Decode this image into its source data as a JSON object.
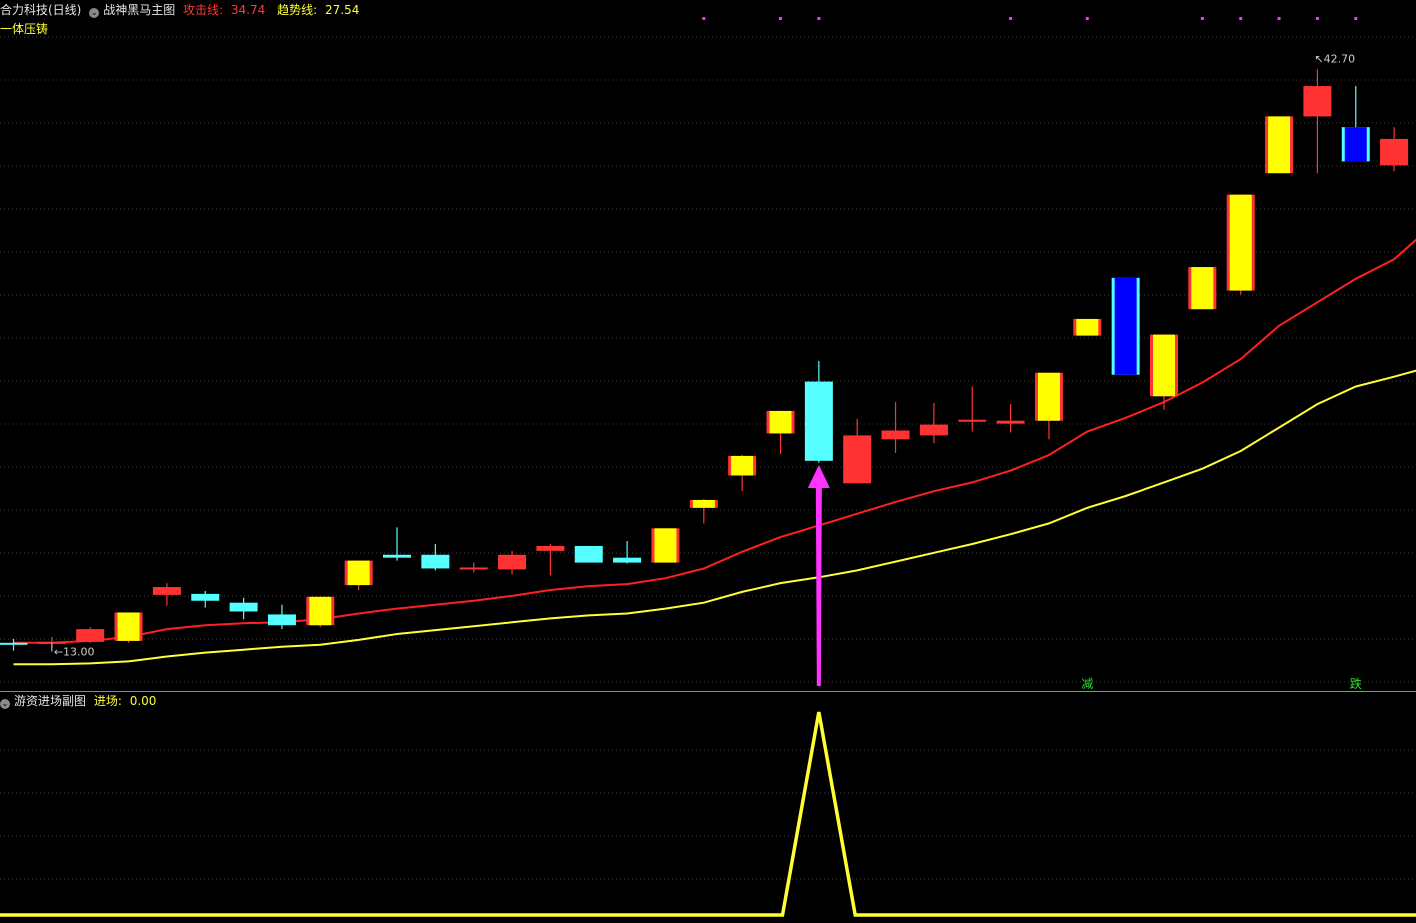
{
  "header": {
    "stock_name": "合力科技(日线)",
    "main_indicator": "战神黑马主图",
    "attack_label": "攻击线:",
    "attack_value": "34.74",
    "trend_label": "趋势线:",
    "trend_value": "27.54",
    "subtitle": "一体压铸"
  },
  "sub_header": {
    "indicator": "游资进场副图",
    "entry_label": "进场:",
    "entry_value": "0.00"
  },
  "colors": {
    "background": "#000000",
    "up_candle": "#ff3333",
    "down_candle": "#55ffff",
    "highlight_fill": "#ffff00",
    "attack_line": "#ff2020",
    "trend_line": "#ffff33",
    "signal_dot": "#ff33ff",
    "arrow": "#ff33ff",
    "marker_text": "#33dd33",
    "grid": "#3a3a3a"
  },
  "chart_data": [
    {
      "type": "candlestick",
      "title": "战神黑马主图",
      "ylim": [
        11.5,
        44
      ],
      "grid": "horizontal dotted",
      "candles": [
        {
          "o": 13.35,
          "c": 13.4,
          "h": 13.6,
          "l": 13.0,
          "style": "cyan"
        },
        {
          "o": 13.35,
          "c": 13.45,
          "h": 13.7,
          "l": 13.1,
          "style": "red"
        },
        {
          "o": 13.45,
          "c": 14.1,
          "h": 14.2,
          "l": 13.4,
          "style": "red"
        },
        {
          "o": 13.5,
          "c": 14.95,
          "h": 14.95,
          "l": 13.4,
          "style": "yellow"
        },
        {
          "o": 15.85,
          "c": 16.25,
          "h": 16.45,
          "l": 15.3,
          "style": "red"
        },
        {
          "o": 15.9,
          "c": 15.55,
          "h": 16.05,
          "l": 15.2,
          "style": "cyan"
        },
        {
          "o": 15.45,
          "c": 15.0,
          "h": 15.7,
          "l": 14.6,
          "style": "cyan"
        },
        {
          "o": 14.85,
          "c": 14.3,
          "h": 15.35,
          "l": 14.1,
          "style": "cyan"
        },
        {
          "o": 14.3,
          "c": 15.75,
          "h": 15.75,
          "l": 14.2,
          "style": "yellow"
        },
        {
          "o": 16.35,
          "c": 17.6,
          "h": 17.6,
          "l": 16.1,
          "style": "yellow"
        },
        {
          "o": 17.9,
          "c": 17.75,
          "h": 19.3,
          "l": 17.6,
          "style": "cyan"
        },
        {
          "o": 17.9,
          "c": 17.2,
          "h": 18.45,
          "l": 17.1,
          "style": "cyan"
        },
        {
          "o": 17.2,
          "c": 17.25,
          "h": 17.5,
          "l": 17.0,
          "style": "red"
        },
        {
          "o": 17.15,
          "c": 17.9,
          "h": 18.1,
          "l": 16.9,
          "style": "red"
        },
        {
          "o": 18.1,
          "c": 18.35,
          "h": 18.45,
          "l": 16.85,
          "style": "red"
        },
        {
          "o": 18.35,
          "c": 17.5,
          "h": 18.35,
          "l": 17.5,
          "style": "cyan"
        },
        {
          "o": 17.75,
          "c": 17.5,
          "h": 18.6,
          "l": 17.45,
          "style": "cyan"
        },
        {
          "o": 17.5,
          "c": 19.25,
          "h": 19.25,
          "l": 17.5,
          "style": "yellow"
        },
        {
          "o": 20.3,
          "c": 20.7,
          "h": 20.75,
          "l": 19.5,
          "style": "yellow"
        },
        {
          "o": 21.95,
          "c": 22.95,
          "h": 23.0,
          "l": 21.15,
          "style": "yellow"
        },
        {
          "o": 24.1,
          "c": 25.25,
          "h": 25.25,
          "l": 23.05,
          "style": "yellow"
        },
        {
          "o": 22.7,
          "c": 26.75,
          "h": 27.8,
          "l": 22.6,
          "style": "cyan"
        },
        {
          "o": 21.55,
          "c": 24.0,
          "h": 24.85,
          "l": 21.55,
          "style": "red"
        },
        {
          "o": 23.8,
          "c": 24.25,
          "h": 25.7,
          "l": 23.1,
          "style": "red"
        },
        {
          "o": 24.0,
          "c": 24.55,
          "h": 25.65,
          "l": 23.6,
          "style": "red"
        },
        {
          "o": 24.75,
          "c": 24.8,
          "h": 26.5,
          "l": 24.2,
          "style": "red"
        },
        {
          "o": 24.6,
          "c": 24.75,
          "h": 25.6,
          "l": 24.15,
          "style": "red"
        },
        {
          "o": 24.75,
          "c": 27.2,
          "h": 27.2,
          "l": 23.8,
          "style": "yellow"
        },
        {
          "o": 29.1,
          "c": 29.95,
          "h": 29.95,
          "l": 29.1,
          "style": "yellow"
        },
        {
          "o": 27.1,
          "c": 32.05,
          "h": 32.05,
          "l": 27.1,
          "style": "blue"
        },
        {
          "o": 26.0,
          "c": 29.15,
          "h": 29.15,
          "l": 25.3,
          "style": "yellow"
        },
        {
          "o": 30.45,
          "c": 32.6,
          "h": 32.6,
          "l": 30.45,
          "style": "yellow"
        },
        {
          "o": 31.4,
          "c": 36.3,
          "h": 36.3,
          "l": 31.2,
          "style": "yellow"
        },
        {
          "o": 37.4,
          "c": 40.3,
          "h": 40.3,
          "l": 37.4,
          "style": "yellow"
        },
        {
          "o": 40.3,
          "c": 41.85,
          "h": 42.7,
          "l": 37.4,
          "style": "red"
        },
        {
          "o": 39.75,
          "c": 38.0,
          "h": 41.85,
          "l": 38.0,
          "style": "blue"
        },
        {
          "o": 37.8,
          "c": 39.15,
          "h": 39.75,
          "l": 37.5,
          "style": "red"
        }
      ],
      "attack_line": [
        13.4,
        13.4,
        13.5,
        13.7,
        14.1,
        14.3,
        14.4,
        14.45,
        14.6,
        14.9,
        15.15,
        15.35,
        15.55,
        15.8,
        16.1,
        16.3,
        16.4,
        16.7,
        17.2,
        18.05,
        18.8,
        19.4,
        20.0,
        20.6,
        21.15,
        21.6,
        22.2,
        23.0,
        24.2,
        24.9,
        25.7,
        26.7,
        27.9,
        29.6,
        30.8,
        32.0,
        33.0,
        34.74
      ],
      "trend_line": [
        12.3,
        12.3,
        12.35,
        12.45,
        12.7,
        12.9,
        13.05,
        13.2,
        13.3,
        13.55,
        13.85,
        14.05,
        14.25,
        14.45,
        14.65,
        14.8,
        14.9,
        15.15,
        15.45,
        16.0,
        16.45,
        16.75,
        17.1,
        17.55,
        18.0,
        18.45,
        18.95,
        19.5,
        20.3,
        20.9,
        21.6,
        22.3,
        23.2,
        24.4,
        25.6,
        26.5,
        27.0,
        27.54
      ],
      "signal_dots": [
        18,
        20,
        21,
        26,
        28,
        31,
        32,
        33,
        34,
        35
      ],
      "arrow_at": 21,
      "labels": [
        {
          "i": 1,
          "text": "13.00",
          "price": 13.0,
          "side": "below"
        },
        {
          "i": 34,
          "text": "42.70",
          "price": 42.7,
          "side": "above"
        }
      ],
      "markers": [
        {
          "i": 28,
          "text": "减"
        },
        {
          "i": 35,
          "text": "跌"
        }
      ]
    },
    {
      "type": "line",
      "title": "游资进场副图",
      "series": [
        {
          "name": "进场",
          "peak_at": 21,
          "peak_value": 1.0,
          "baseline": 0.0
        }
      ],
      "ylim": [
        0,
        1
      ]
    }
  ]
}
